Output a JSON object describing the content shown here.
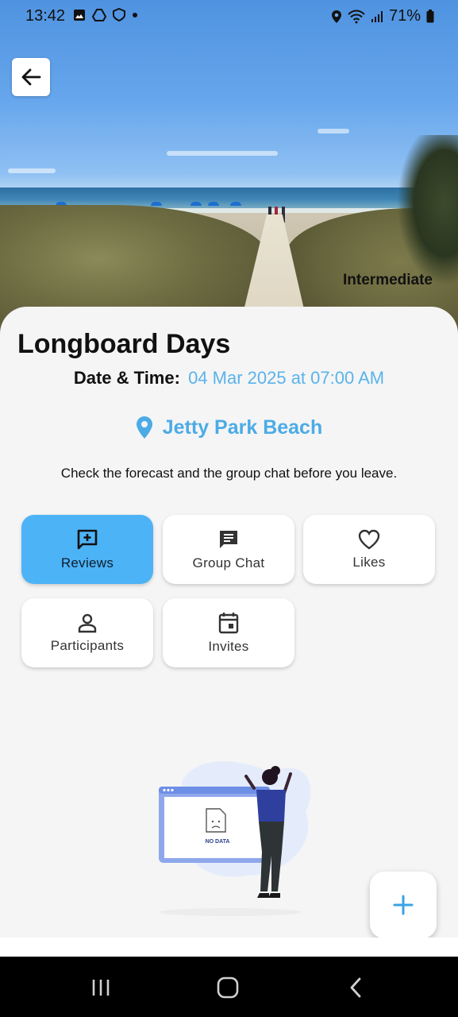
{
  "status_bar": {
    "time": "13:42",
    "battery": "71%"
  },
  "hero": {
    "level_tag": "Intermediate"
  },
  "event": {
    "title": "Longboard Days",
    "date_label": "Date & Time:",
    "date_value": "04 Mar 2025 at 07:00 AM",
    "location": "Jetty Park Beach",
    "description": "Check the forecast and the group chat before you leave."
  },
  "tabs": [
    {
      "label": "Reviews",
      "icon": "reviews-icon",
      "active": true
    },
    {
      "label": "Group Chat",
      "icon": "chat-icon",
      "active": false
    },
    {
      "label": "Likes",
      "icon": "heart-icon",
      "active": false
    },
    {
      "label": "Participants",
      "icon": "person-icon",
      "active": false
    },
    {
      "label": "Invites",
      "icon": "calendar-icon",
      "active": false
    }
  ],
  "empty_state": {
    "text": "NO DATA"
  },
  "colors": {
    "accent": "#4db3f7",
    "link": "#5ab3ea",
    "location": "#4cabe6"
  }
}
